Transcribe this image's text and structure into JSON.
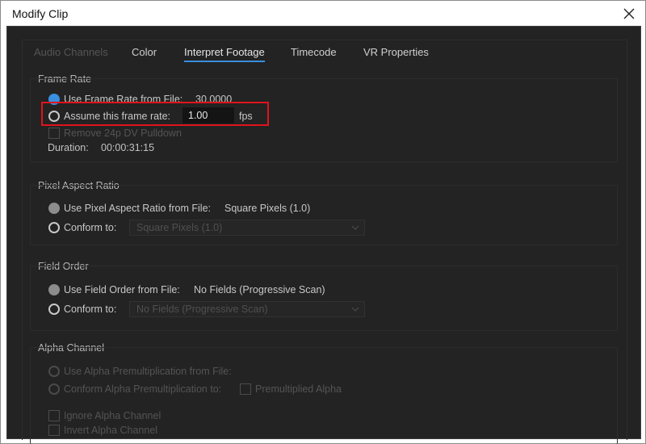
{
  "window": {
    "title": "Modify Clip"
  },
  "tabs": [
    {
      "label": "Audio Channels",
      "state": "disabled"
    },
    {
      "label": "Color",
      "state": "normal"
    },
    {
      "label": "Interpret Footage",
      "state": "active"
    },
    {
      "label": "Timecode",
      "state": "normal"
    },
    {
      "label": "VR Properties",
      "state": "normal"
    }
  ],
  "frame_rate": {
    "group_label": "Frame Rate",
    "use_from_file_label": "Use Frame Rate from File:",
    "file_value": "30.0000",
    "assume_label": "Assume this frame rate:",
    "assume_value": "1.00",
    "fps_unit": "fps",
    "remove_pulldown_label": "Remove 24p DV Pulldown",
    "duration_label": "Duration:",
    "duration_value": "00:00:31:15"
  },
  "pixel_aspect": {
    "group_label": "Pixel Aspect Ratio",
    "use_from_file_label": "Use Pixel Aspect Ratio from File:",
    "file_value": "Square Pixels (1.0)",
    "conform_label": "Conform to:",
    "conform_value": "Square Pixels (1.0)"
  },
  "field_order": {
    "group_label": "Field Order",
    "use_from_file_label": "Use Field Order from File:",
    "file_value": "No Fields (Progressive Scan)",
    "conform_label": "Conform to:",
    "conform_value": "No Fields (Progressive Scan)"
  },
  "alpha_channel": {
    "group_label": "Alpha Channel",
    "use_premult_label": "Use Alpha Premultiplication from File:",
    "conform_premult_label": "Conform Alpha Premultiplication to:",
    "premultiplied_label": "Premultiplied Alpha",
    "ignore_label": "Ignore Alpha Channel",
    "invert_label": "Invert Alpha Channel"
  },
  "colors": {
    "accent": "#3a8fde",
    "highlight_box": "#e0141c",
    "dialog_bg": "#232323"
  }
}
